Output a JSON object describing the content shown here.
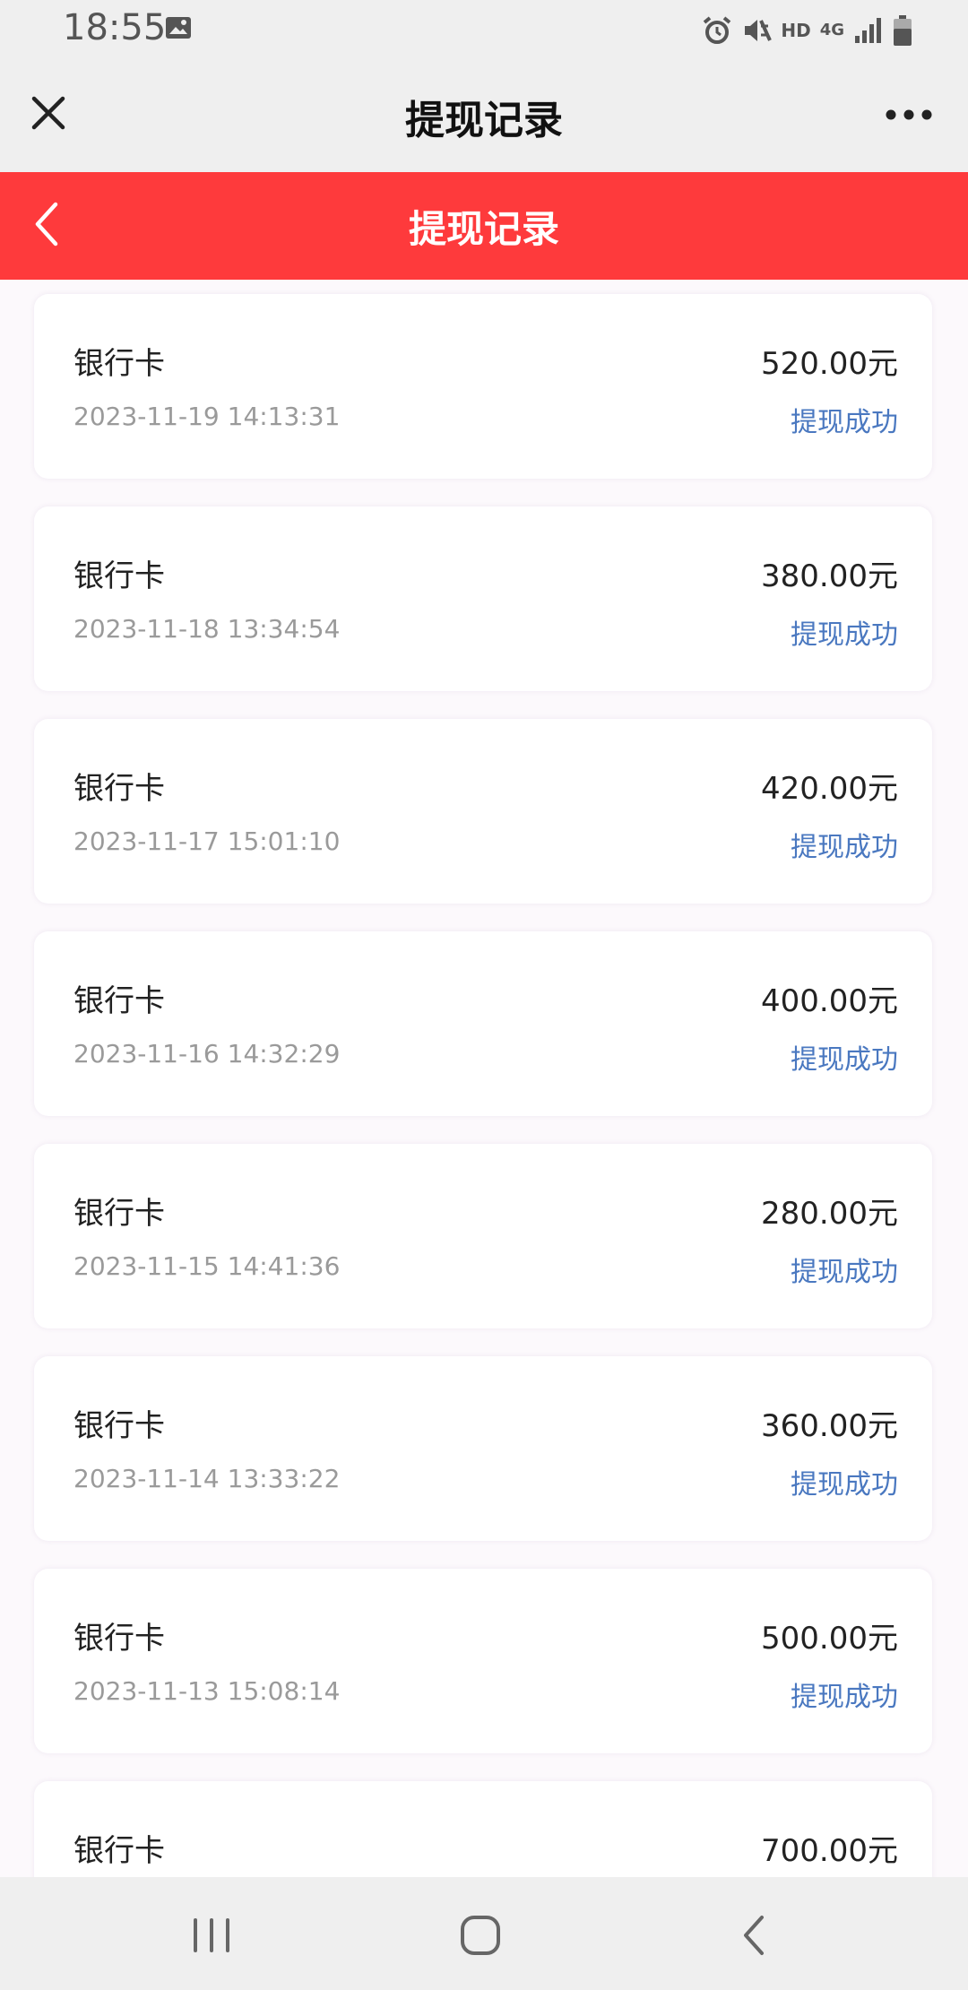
{
  "status_bar": {
    "time": "18:55",
    "hd_label": "HD",
    "network_label": "4G"
  },
  "title_bar": {
    "title": "提现记录"
  },
  "header": {
    "title": "提现记录",
    "color": "#fe3a3c"
  },
  "records": [
    {
      "name": "银行卡",
      "time": "2023-11-19 14:13:31",
      "amount": "520.00元",
      "status": "提现成功"
    },
    {
      "name": "银行卡",
      "time": "2023-11-18 13:34:54",
      "amount": "380.00元",
      "status": "提现成功"
    },
    {
      "name": "银行卡",
      "time": "2023-11-17 15:01:10",
      "amount": "420.00元",
      "status": "提现成功"
    },
    {
      "name": "银行卡",
      "time": "2023-11-16 14:32:29",
      "amount": "400.00元",
      "status": "提现成功"
    },
    {
      "name": "银行卡",
      "time": "2023-11-15 14:41:36",
      "amount": "280.00元",
      "status": "提现成功"
    },
    {
      "name": "银行卡",
      "time": "2023-11-14 13:33:22",
      "amount": "360.00元",
      "status": "提现成功"
    },
    {
      "name": "银行卡",
      "time": "2023-11-13 15:08:14",
      "amount": "500.00元",
      "status": "提现成功"
    },
    {
      "name": "银行卡",
      "time": "",
      "amount": "700.00元",
      "status": ""
    }
  ],
  "colors": {
    "status_success": "#4a78c0"
  }
}
